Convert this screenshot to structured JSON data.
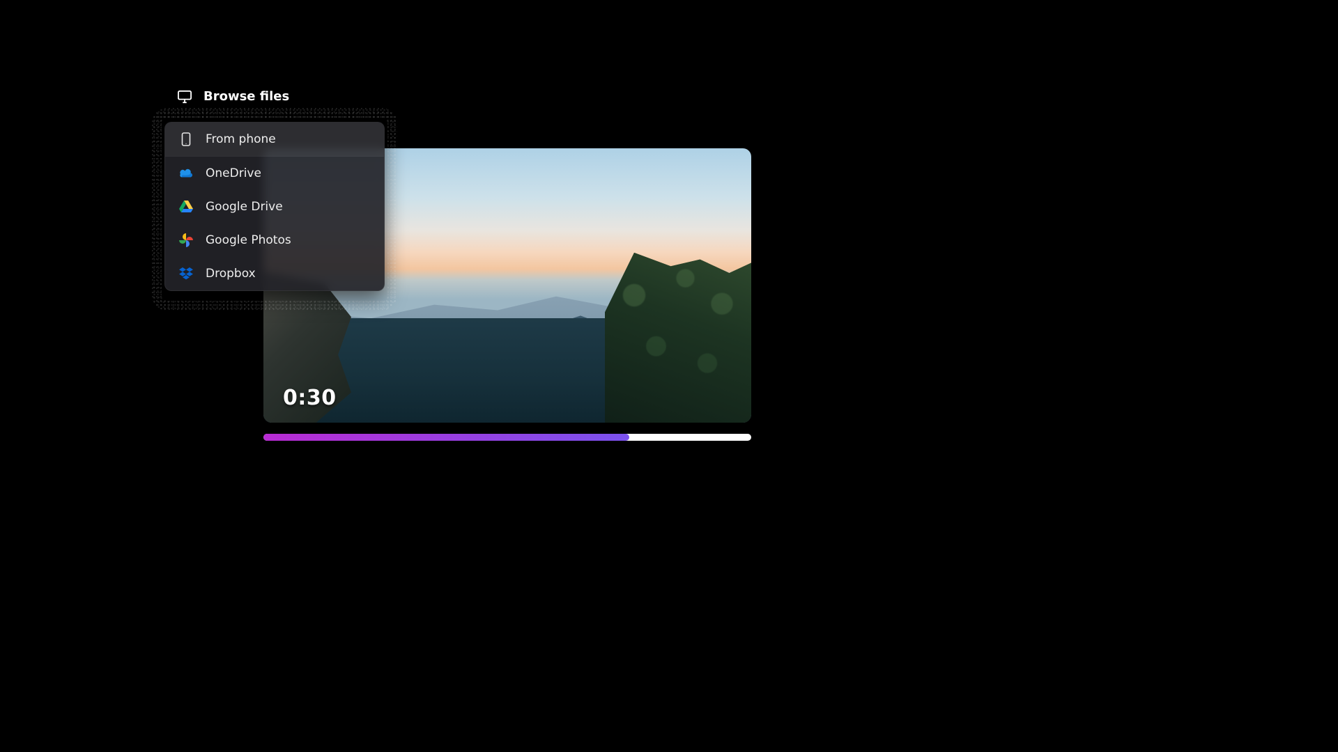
{
  "browse": {
    "label": "Browse files"
  },
  "menu": {
    "items": [
      {
        "label": "From phone"
      },
      {
        "label": "OneDrive"
      },
      {
        "label": "Google Drive"
      },
      {
        "label": "Google Photos"
      },
      {
        "label": "Dropbox"
      }
    ]
  },
  "video": {
    "timestamp": "0:30",
    "progress_percent": 75
  },
  "colors": {
    "progress_start": "#b92bd3",
    "progress_end": "#7b52ee"
  }
}
